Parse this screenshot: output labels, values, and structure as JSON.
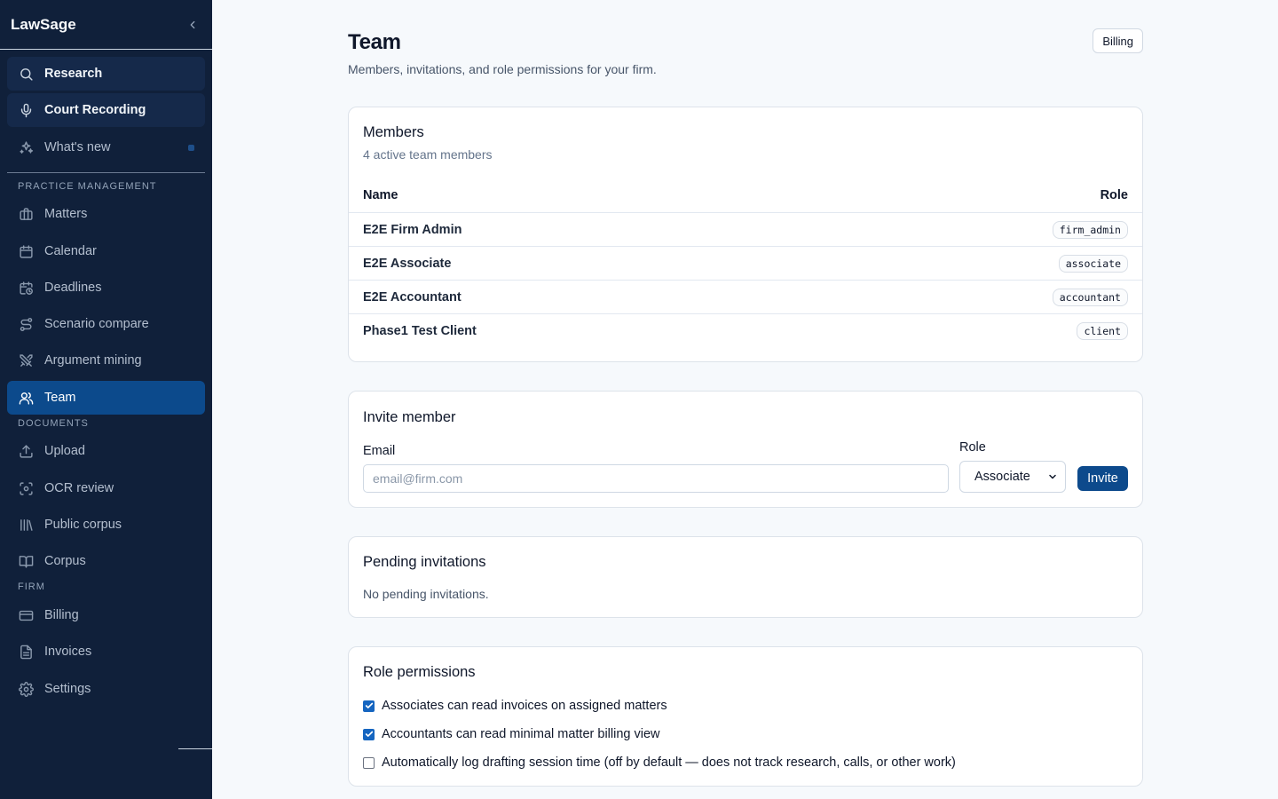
{
  "app": {
    "name": "LawSage"
  },
  "sidebar": {
    "top_items": [
      {
        "label": "Research",
        "icon": "search-icon"
      },
      {
        "label": "Court Recording",
        "icon": "microphone-icon"
      },
      {
        "label": "What's new",
        "icon": "sparkles-icon"
      }
    ],
    "sections": [
      {
        "label": "PRACTICE MANAGEMENT",
        "items": [
          {
            "label": "Matters",
            "icon": "briefcase-icon"
          },
          {
            "label": "Calendar",
            "icon": "calendar-icon"
          },
          {
            "label": "Deadlines",
            "icon": "calendar-clock-icon"
          },
          {
            "label": "Scenario compare",
            "icon": "route-icon"
          },
          {
            "label": "Argument mining",
            "icon": "swords-icon"
          },
          {
            "label": "Team",
            "icon": "users-icon",
            "active": true
          }
        ]
      },
      {
        "label": "DOCUMENTS",
        "items": [
          {
            "label": "Upload",
            "icon": "upload-icon"
          },
          {
            "label": "OCR review",
            "icon": "scan-icon"
          },
          {
            "label": "Public corpus",
            "icon": "library-icon"
          },
          {
            "label": "Corpus",
            "icon": "book-open-icon"
          }
        ]
      },
      {
        "label": "FIRM",
        "items": [
          {
            "label": "Billing",
            "icon": "credit-card-icon"
          },
          {
            "label": "Invoices",
            "icon": "file-text-icon"
          },
          {
            "label": "Settings",
            "icon": "gear-icon"
          }
        ]
      }
    ]
  },
  "header": {
    "title": "Team",
    "subtitle": "Members, invitations, and role permissions for your firm.",
    "billing_label": "Billing"
  },
  "members": {
    "title": "Members",
    "subtitle": "4 active team members",
    "columns": [
      "Name",
      "Role"
    ],
    "rows": [
      {
        "name": "E2E Firm Admin",
        "role": "firm_admin"
      },
      {
        "name": "E2E Associate",
        "role": "associate"
      },
      {
        "name": "E2E Accountant",
        "role": "accountant"
      },
      {
        "name": "Phase1 Test Client",
        "role": "client"
      }
    ]
  },
  "invite": {
    "title": "Invite member",
    "email_label": "Email",
    "email_placeholder": "email@firm.com",
    "email_value": "",
    "role_label": "Role",
    "role_selected": "Associate",
    "submit_label": "Invite"
  },
  "pending": {
    "title": "Pending invitations",
    "empty_text": "No pending invitations."
  },
  "permissions": {
    "title": "Role permissions",
    "items": [
      {
        "label": "Associates can read invoices on assigned matters",
        "checked": true
      },
      {
        "label": "Accountants can read minimal matter billing view",
        "checked": true
      },
      {
        "label": "Automatically log drafting session time (off by default — does not track research, calls, or other work)",
        "checked": false
      }
    ]
  },
  "colors": {
    "sidebar_bg": "#10203a",
    "accent": "#0c4a8c",
    "checkbox": "#1565c0"
  }
}
